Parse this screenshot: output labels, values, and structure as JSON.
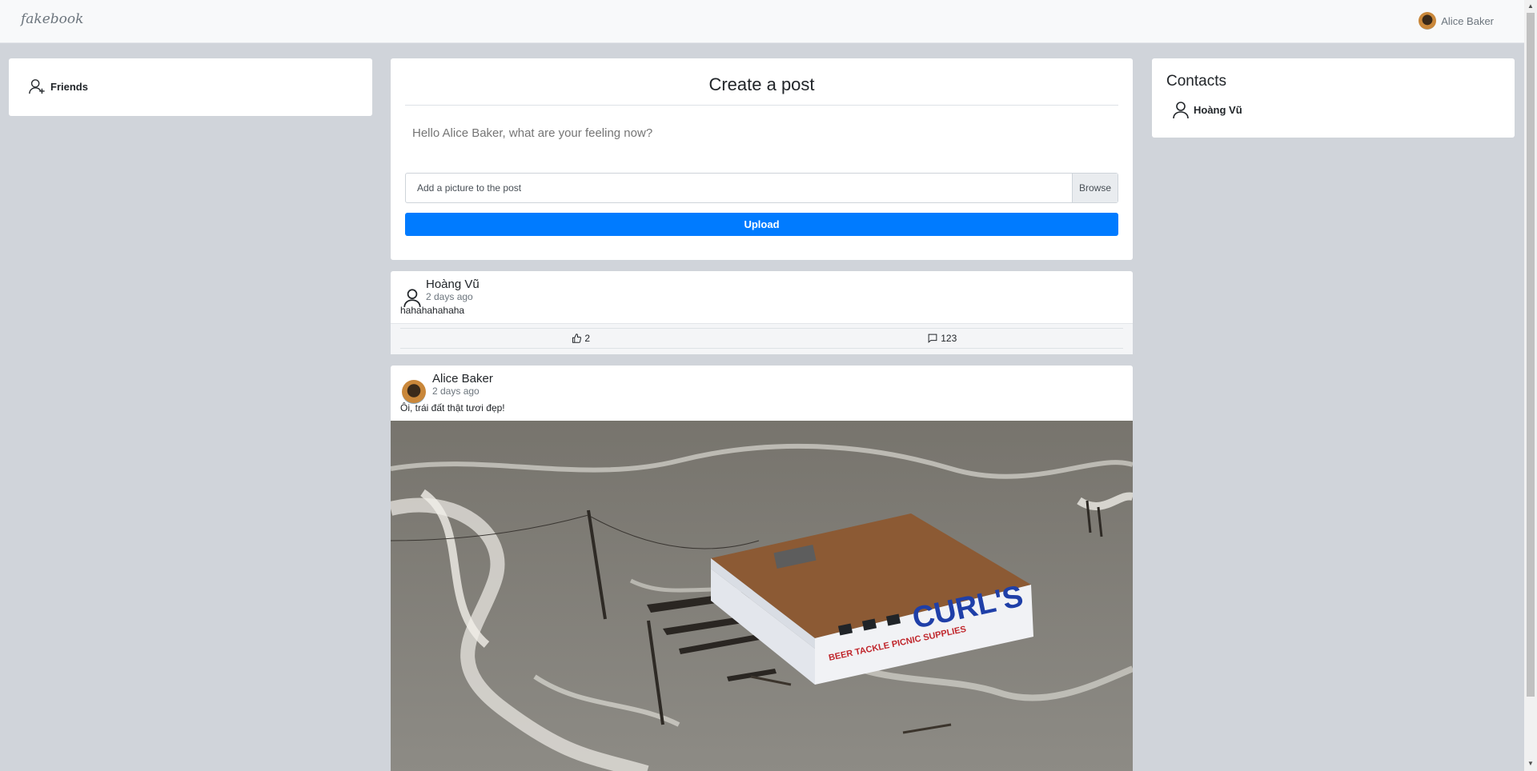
{
  "navbar": {
    "brand": "fakebook",
    "user_name": "Alice Baker"
  },
  "sidebar": {
    "friends_label": "Friends"
  },
  "contacts": {
    "title": "Contacts",
    "items": [
      {
        "name": "Hoàng Vũ"
      }
    ]
  },
  "create_post": {
    "title": "Create a post",
    "status_placeholder": "Hello Alice Baker, what are your feeling now?",
    "file_placeholder": "Add a picture to the post",
    "browse_label": "Browse",
    "upload_label": "Upload"
  },
  "posts": [
    {
      "author": "Hoàng Vũ",
      "time": "2 days ago",
      "text": "hahahahahaha",
      "likes": "2",
      "comments": "123"
    },
    {
      "author": "Alice Baker",
      "time": "2 days ago",
      "text": "Ôi, trái đất thật tươi đẹp!",
      "image_sign": "CURL'S",
      "image_sign_sub": "BEER TACKLE PICNIC SUPPLIES"
    }
  ],
  "colors": {
    "primary": "#007bff",
    "page_bg": "#d0d4da",
    "navbar_bg": "#f8f9fa"
  }
}
